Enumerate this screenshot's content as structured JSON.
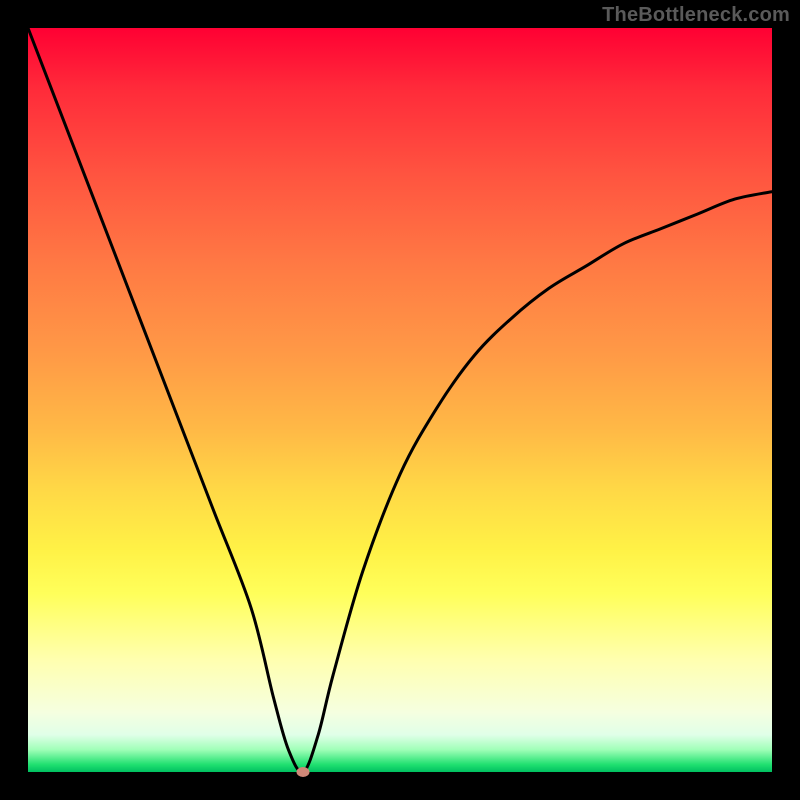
{
  "watermark": "TheBottleneck.com",
  "chart_data": {
    "type": "line",
    "title": "",
    "xlabel": "",
    "ylabel": "",
    "xlim": [
      0,
      100
    ],
    "ylim": [
      0,
      100
    ],
    "x": [
      0,
      5,
      10,
      15,
      20,
      25,
      30,
      33,
      35,
      37,
      39,
      41,
      45,
      50,
      55,
      60,
      65,
      70,
      75,
      80,
      85,
      90,
      95,
      100
    ],
    "values": [
      100,
      87,
      74,
      61,
      48,
      35,
      22,
      10,
      3,
      0,
      5,
      13,
      27,
      40,
      49,
      56,
      61,
      65,
      68,
      71,
      73,
      75,
      77,
      78
    ],
    "marker_point": {
      "x": 37,
      "y": 0
    },
    "gradient_stops": [
      {
        "pos": 0.0,
        "color": "#ff0033"
      },
      {
        "pos": 0.5,
        "color": "#ffc046"
      },
      {
        "pos": 0.8,
        "color": "#ffff80"
      },
      {
        "pos": 1.0,
        "color": "#00c060"
      }
    ]
  }
}
